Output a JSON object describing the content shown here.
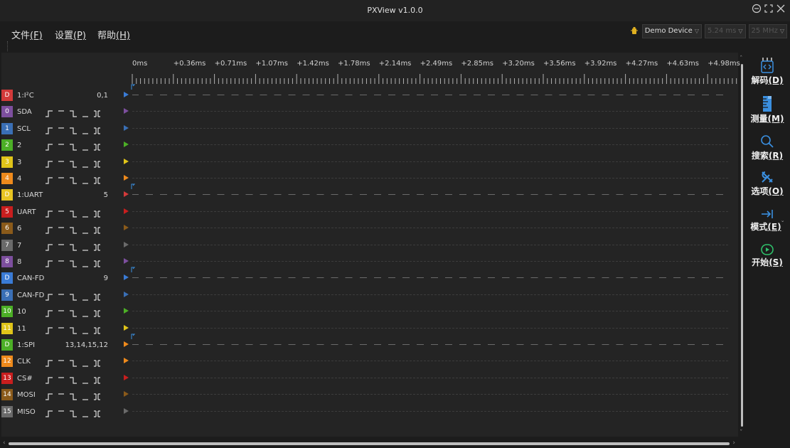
{
  "window": {
    "title": "PXView v1.0.0"
  },
  "menu": [
    {
      "label": "文件",
      "key": "(F)"
    },
    {
      "label": "设置",
      "key": "(P)"
    },
    {
      "label": "帮助",
      "key": "(H)"
    }
  ],
  "device": {
    "name": "Demo Device",
    "sample_count": "5.24 ms",
    "sample_rate": "25 MHz"
  },
  "ruler": {
    "labels": [
      "0ms",
      "+0.36ms",
      "+0.71ms",
      "+1.07ms",
      "+1.42ms",
      "+1.78ms",
      "+2.14ms",
      "+2.49ms",
      "+2.85ms",
      "+3.20ms",
      "+3.56ms",
      "+3.92ms",
      "+4.27ms",
      "+4.63ms",
      "+4.98ms"
    ]
  },
  "channels": [
    {
      "badge": "D",
      "name": "1:I²C",
      "value": "0,1",
      "type": "decoder",
      "color": "#d33a3a",
      "marker": "#3a7bd5"
    },
    {
      "badge": "0",
      "name": "SDA",
      "value": "",
      "type": "logic",
      "color": "#7d4f9e",
      "marker": "#7d4f9e"
    },
    {
      "badge": "1",
      "name": "SCL",
      "value": "",
      "type": "logic",
      "color": "#3a6fb5",
      "marker": "#3a6fb5"
    },
    {
      "badge": "2",
      "name": "2",
      "value": "",
      "type": "logic",
      "color": "#4caf26",
      "marker": "#4caf26"
    },
    {
      "badge": "3",
      "name": "3",
      "value": "",
      "type": "logic",
      "color": "#e0c419",
      "marker": "#e0c419"
    },
    {
      "badge": "4",
      "name": "4",
      "value": "",
      "type": "logic",
      "color": "#ee8a1c",
      "marker": "#ee8a1c"
    },
    {
      "badge": "D",
      "name": "1:UART",
      "value": "5",
      "type": "decoder",
      "color": "#e8c422",
      "marker": "#d33a3a"
    },
    {
      "badge": "5",
      "name": "UART",
      "value": "",
      "type": "logic",
      "color": "#c81e1e",
      "marker": "#c81e1e"
    },
    {
      "badge": "6",
      "name": "6",
      "value": "",
      "type": "logic",
      "color": "#8a5a1a",
      "marker": "#8a5a1a"
    },
    {
      "badge": "7",
      "name": "7",
      "value": "",
      "type": "logic",
      "color": "#6a6a6a",
      "marker": "#6a6a6a"
    },
    {
      "badge": "8",
      "name": "8",
      "value": "",
      "type": "logic",
      "color": "#7d4f9e",
      "marker": "#7d4f9e"
    },
    {
      "badge": "D",
      "name": "CAN-FD",
      "value": "9",
      "type": "decoder",
      "color": "#3a7bd5",
      "marker": "#3a7bd5"
    },
    {
      "badge": "9",
      "name": "CAN-FD",
      "value": "",
      "type": "logic",
      "color": "#3a6fb5",
      "marker": "#3a6fb5"
    },
    {
      "badge": "10",
      "name": "10",
      "value": "",
      "type": "logic",
      "color": "#4caf26",
      "marker": "#4caf26"
    },
    {
      "badge": "11",
      "name": "11",
      "value": "",
      "type": "logic",
      "color": "#e0c419",
      "marker": "#e0c419"
    },
    {
      "badge": "D",
      "name": "1:SPI",
      "value": "13,14,15,12",
      "type": "decoder",
      "color": "#4caf26",
      "marker": "#ee8a1c"
    },
    {
      "badge": "12",
      "name": "CLK",
      "value": "",
      "type": "logic",
      "color": "#ee8a1c",
      "marker": "#ee8a1c"
    },
    {
      "badge": "13",
      "name": "CS#",
      "value": "",
      "type": "logic",
      "color": "#c81e1e",
      "marker": "#c81e1e"
    },
    {
      "badge": "14",
      "name": "MOSI",
      "value": "",
      "type": "logic",
      "color": "#8a5a1a",
      "marker": "#8a5a1a"
    },
    {
      "badge": "15",
      "name": "MISO",
      "value": "",
      "type": "logic",
      "color": "#6a6a6a",
      "marker": "#6a6a6a"
    }
  ],
  "sidebar": [
    {
      "label": "解码",
      "key": "(D)",
      "icon": "decode-icon"
    },
    {
      "label": "测量",
      "key": "(M)",
      "icon": "ruler-icon"
    },
    {
      "label": "搜索",
      "key": "(R)",
      "icon": "search-icon"
    },
    {
      "label": "选项",
      "key": "(O)",
      "icon": "tools-icon"
    },
    {
      "label": "模式",
      "key": "(E)",
      "icon": "mode-arrow-icon"
    },
    {
      "label": "开始",
      "key": "(S)",
      "icon": "play-icon"
    }
  ],
  "colors": {
    "accent": "#3a8fe0",
    "background": "#1c1c1c",
    "panel": "#242424"
  }
}
